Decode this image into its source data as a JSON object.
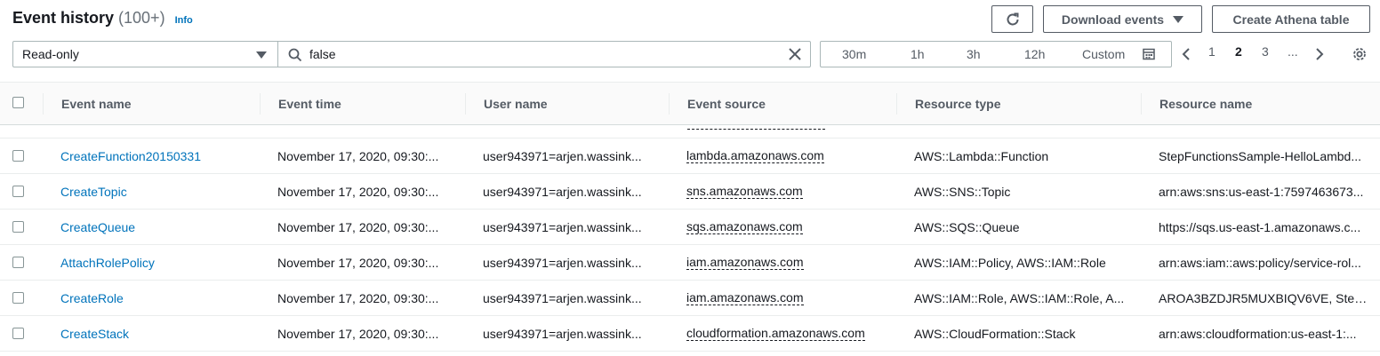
{
  "header": {
    "title": "Event history",
    "count": "(100+)",
    "info": "Info"
  },
  "toolbar": {
    "download_label": "Download events",
    "athena_label": "Create Athena table"
  },
  "filter": {
    "attribute": "Read-only",
    "value": "false"
  },
  "time_range": {
    "options": [
      "30m",
      "1h",
      "3h",
      "12h",
      "Custom"
    ]
  },
  "pagination": {
    "pages": [
      "1",
      "2",
      "3",
      "..."
    ],
    "current": "2"
  },
  "table": {
    "columns": [
      "Event name",
      "Event time",
      "User name",
      "Event source",
      "Resource type",
      "Resource name"
    ],
    "rows": [
      {
        "name": "CreateFunction20150331",
        "time": "November 17, 2020, 09:30:...",
        "user": "user943971=arjen.wassink...",
        "source": "lambda.amazonaws.com",
        "rtype": "AWS::Lambda::Function",
        "rname": "StepFunctionsSample-HelloLambd..."
      },
      {
        "name": "CreateTopic",
        "time": "November 17, 2020, 09:30:...",
        "user": "user943971=arjen.wassink...",
        "source": "sns.amazonaws.com",
        "rtype": "AWS::SNS::Topic",
        "rname": "arn:aws:sns:us-east-1:7597463673..."
      },
      {
        "name": "CreateQueue",
        "time": "November 17, 2020, 09:30:...",
        "user": "user943971=arjen.wassink...",
        "source": "sqs.amazonaws.com",
        "rtype": "AWS::SQS::Queue",
        "rname": "https://sqs.us-east-1.amazonaws.c..."
      },
      {
        "name": "AttachRolePolicy",
        "time": "November 17, 2020, 09:30:...",
        "user": "user943971=arjen.wassink...",
        "source": "iam.amazonaws.com",
        "rtype": "AWS::IAM::Policy, AWS::IAM::Role",
        "rname": "arn:aws:iam::aws:policy/service-rol..."
      },
      {
        "name": "CreateRole",
        "time": "November 17, 2020, 09:30:...",
        "user": "user943971=arjen.wassink...",
        "source": "iam.amazonaws.com",
        "rtype": "AWS::IAM::Role, AWS::IAM::Role, A...",
        "rname": "AROA3BZDJR5MUXBIQV6VE, Step..."
      },
      {
        "name": "CreateStack",
        "time": "November 17, 2020, 09:30:...",
        "user": "user943971=arjen.wassink...",
        "source": "cloudformation.amazonaws.com",
        "rtype": "AWS::CloudFormation::Stack",
        "rname": "arn:aws:cloudformation:us-east-1:..."
      }
    ]
  },
  "colors": {
    "link": "#0073bb",
    "text": "#16191f",
    "muted": "#545b64",
    "border": "#aab7b8"
  }
}
